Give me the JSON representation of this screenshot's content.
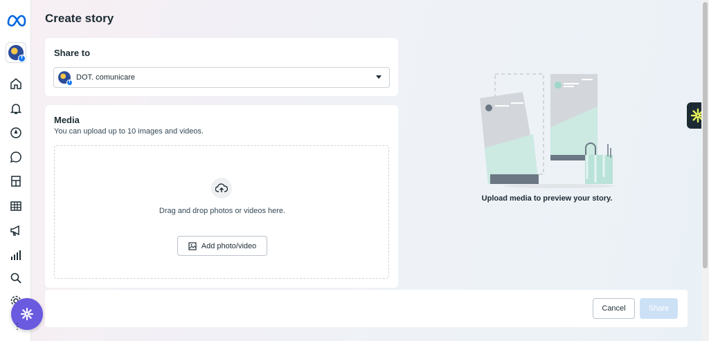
{
  "page": {
    "title": "Create story"
  },
  "share_to": {
    "heading": "Share to",
    "selected_account": "DOT. comunicare"
  },
  "media": {
    "heading": "Media",
    "hint": "You can upload up to 10 images and videos.",
    "drop_text": "Drag and drop photos or videos here.",
    "add_button": "Add photo/video"
  },
  "preview": {
    "label": "Upload media to preview your story."
  },
  "footer": {
    "cancel": "Cancel",
    "share": "Share"
  },
  "sidebar": {
    "icons": [
      "meta-logo-icon",
      "account-avatar",
      "home-icon",
      "bell-icon",
      "compass-icon",
      "chat-icon",
      "pages-icon",
      "table-icon",
      "megaphone-icon",
      "bar-chart-icon",
      "search-icon",
      "settings-icon"
    ]
  },
  "colors": {
    "accent": "#1877f2",
    "share_disabled": "#cde1f6",
    "helper_button": "#6a5ae0"
  }
}
